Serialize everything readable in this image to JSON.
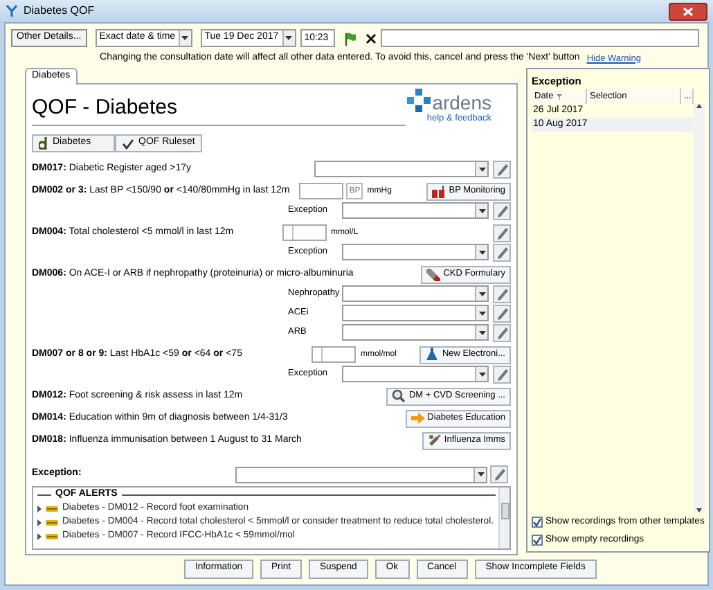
{
  "window": {
    "title": "Diabetes QOF"
  },
  "toolbar": {
    "other_details": "Other Details...",
    "date_mode": "Exact date & time",
    "date": "Tue 19 Dec 2017",
    "time": "10:23"
  },
  "warning": {
    "text": "Changing the consultation date will affect all other data entered. To avoid this, cancel and press the 'Next' button",
    "link": "Hide Warning"
  },
  "tabs": [
    {
      "label": "Diabetes",
      "selected": true
    }
  ],
  "form": {
    "title": "QOF - Diabetes",
    "logo": {
      "name": "ardens",
      "link": "help & feedback"
    },
    "sub_buttons": [
      {
        "label": "Diabetes"
      },
      {
        "label": "QOF Ruleset"
      }
    ],
    "rows": [
      {
        "kind": "select",
        "label": "**DM017:** Diabetic Register aged >17y"
      },
      {
        "kind": "measure",
        "label": "**DM002 or 3:** Last BP <150/90 **or** <140/80mmHg in last 12m",
        "badge": "BP",
        "unit": "mmHg",
        "button": "BP Monitoring"
      },
      {
        "kind": "labeled_select",
        "label": "Exception"
      },
      {
        "kind": "split_measure",
        "label": "**DM004:** Total cholesterol <5 mmol/l in last 12m",
        "unit": "mmol/L"
      },
      {
        "kind": "labeled_select",
        "label": "Exception"
      },
      {
        "kind": "heading",
        "label": "**DM006:** On ACE-I or ARB if nephropathy (proteinuria) or micro-albuminuria",
        "button": "CKD Formulary"
      },
      {
        "kind": "labeled_select",
        "label": "Nephropathy"
      },
      {
        "kind": "labeled_select",
        "label": "ACEi"
      },
      {
        "kind": "labeled_select",
        "label": "ARB"
      },
      {
        "kind": "split_measure",
        "label": "**DM007 or 8 or 9:** Last HbA1c <59 **or** <64 **or** <75",
        "unit": "mmol/mol",
        "button": "New Electroni..."
      },
      {
        "kind": "labeled_select",
        "label": "Exception"
      },
      {
        "kind": "heading",
        "label": "**DM012:** Foot screening & risk assess in last 12m",
        "button": "DM + CVD Screening ..."
      },
      {
        "kind": "heading",
        "label": "**DM014:** Education within 9m of diagnosis between 1/4-31/3",
        "button": "Diabetes Education"
      },
      {
        "kind": "heading",
        "label": "**DM018:** Influenza immunisation between 1 August to 31 March",
        "button": "Influenza Imms"
      }
    ],
    "exception_label": "Exception:"
  },
  "alerts": {
    "title": "QOF ALERTS",
    "items": [
      "Diabetes - DM012 - Record foot examination",
      "Diabetes - DM004 -  Record total cholesterol < 5mmol/l or consider treatment to reduce total cholesterol.",
      "Diabetes - DM007 - Record IFCC-HbA1c < 59mmol/mol"
    ]
  },
  "exception_panel": {
    "title": "Exception",
    "columns": [
      "Date",
      "Selection",
      "..."
    ],
    "rows": [
      {
        "date": "26 Jul 2017",
        "selected": false
      },
      {
        "date": "10 Aug 2017",
        "selected": true
      }
    ],
    "options": [
      {
        "label": "Show recordings from other templates",
        "checked": true
      },
      {
        "label": "Show empty recordings",
        "checked": true
      }
    ]
  },
  "buttons": [
    "Information",
    "Print",
    "Suspend",
    "Ok",
    "Cancel",
    "Show Incomplete Fields"
  ]
}
